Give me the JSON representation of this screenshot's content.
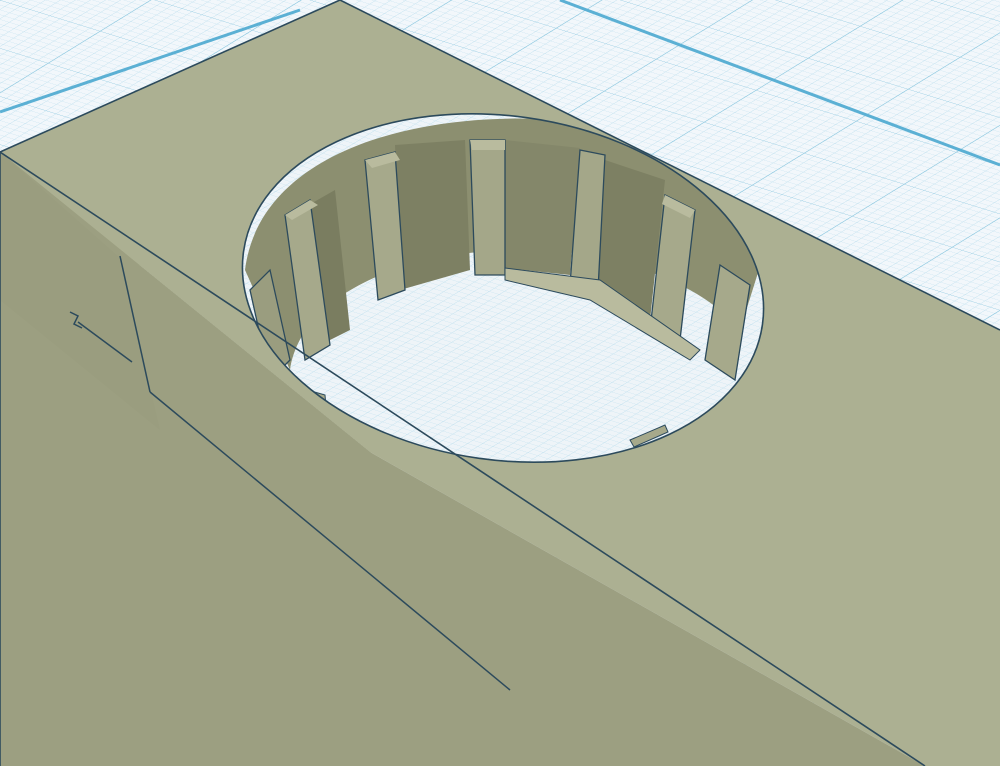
{
  "app": {
    "workplane_watermark": ""
  },
  "colors": {
    "background": "#f2f7fb",
    "grid_minor": "#bfe0ee",
    "grid_major": "#85c4dd",
    "grid_border": "#5bb0d4",
    "model_top": "#acb092",
    "model_left_face": "#989c7c",
    "model_front_face": "#9b9e80",
    "model_edge": "#2c4a5c",
    "hole_wall_dark": "#7a7d60",
    "hole_wall_mid": "#8c8f70",
    "hole_rib_light": "#b9bb9e",
    "hole_floor": "#eef4f8"
  },
  "scene": {
    "object": "box-with-circular-hole",
    "rib_count": 12
  }
}
